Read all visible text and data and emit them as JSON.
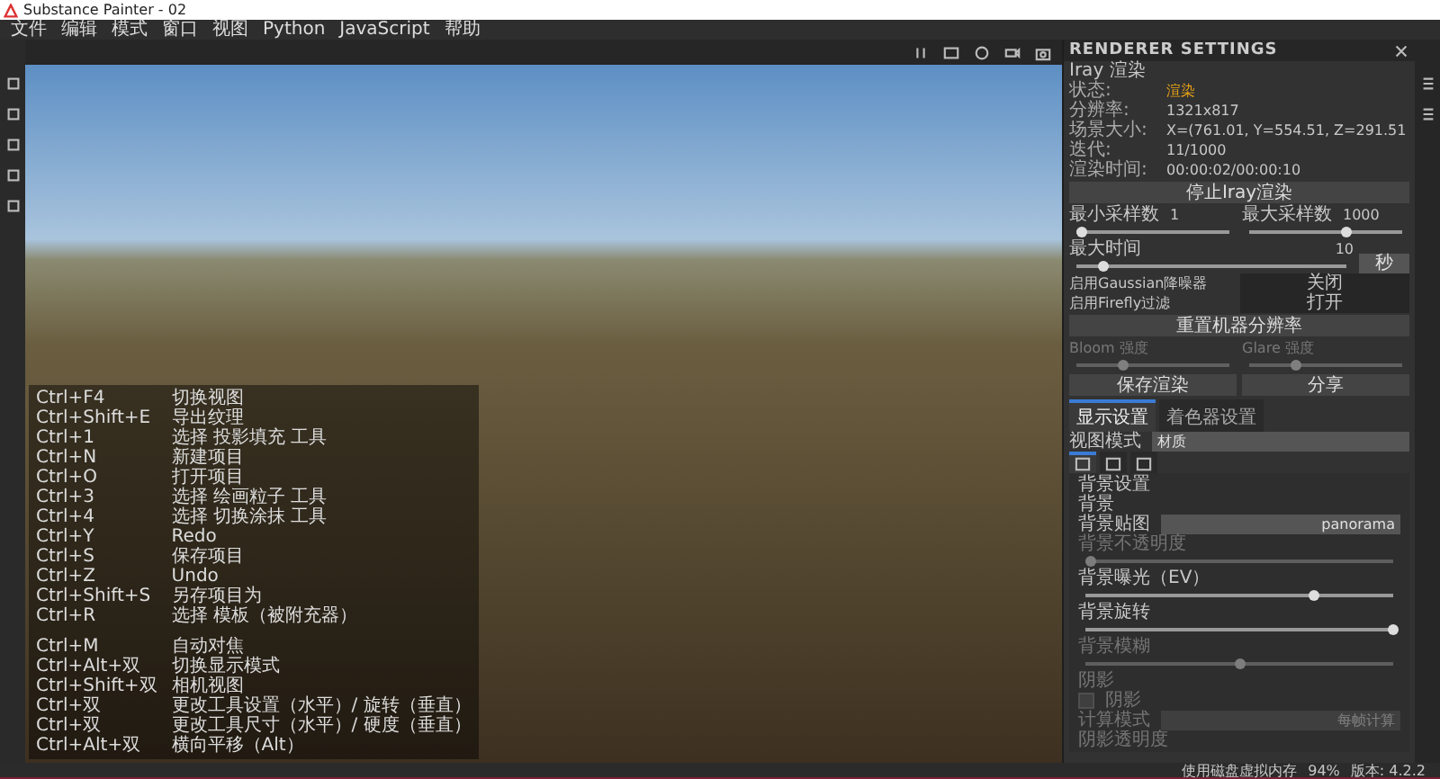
{
  "window": {
    "title": "Substance Painter - 02"
  },
  "menu": [
    "文件",
    "编辑",
    "模式",
    "窗口",
    "视图",
    "Python",
    "JavaScript",
    "帮助"
  ],
  "renderer": {
    "title": "RENDERER SETTINGS",
    "subtitle": "Iray 渲染",
    "info": [
      {
        "label": "状态:",
        "value": "渲染",
        "color": "#e8a317"
      },
      {
        "label": "分辨率:",
        "value": "1321x817"
      },
      {
        "label": "场景大小:",
        "value": "X=(761.01, Y=554.51, Z=291.51"
      },
      {
        "label": "迭代:",
        "value": "11/1000"
      },
      {
        "label": "渲染时间:",
        "value": "00:00:02/00:00:10"
      }
    ],
    "stop_button": "停止Iray渲染",
    "min_samples": {
      "label": "最小采样数",
      "value": "1",
      "level": 0.03
    },
    "max_samples": {
      "label": "最大采样数",
      "value": "1000",
      "level": 0.63
    },
    "max_time": {
      "label": "最大时间",
      "value": "10",
      "level": 0.1,
      "unit": "秒"
    },
    "toggles": [
      {
        "label": "启用Gaussian降噪器",
        "value": "关闭"
      },
      {
        "label": "启用Firefly过滤",
        "value": "打开"
      }
    ],
    "reset_button": "重置机器分辨率",
    "effects": [
      {
        "label": "Bloom 强度",
        "level": 0.3
      },
      {
        "label": "Glare 强度",
        "level": 0.3
      }
    ],
    "save_button": "保存渲染",
    "share_button": "分享"
  },
  "display": {
    "tabs": [
      {
        "label": "显示设置",
        "selected": true
      },
      {
        "label": "着色器设置",
        "selected": false
      }
    ],
    "view_mode": {
      "label": "视图模式",
      "value": "材质"
    },
    "icon_tabs": [
      {
        "selected": true
      },
      {
        "selected": false
      },
      {
        "selected": false
      }
    ],
    "section": "背景设置",
    "group": "背景",
    "rows": [
      {
        "kind": "field",
        "label": "背景贴图",
        "value": "panorama",
        "disabled": false
      },
      {
        "kind": "slider",
        "label": "背景不透明度",
        "level": 0.02,
        "disabled": true
      },
      {
        "kind": "slider",
        "label": "背景曝光（EV）",
        "level": 0.74,
        "disabled": false
      },
      {
        "kind": "slider",
        "label": "背景旋转",
        "level": 1,
        "disabled": false
      },
      {
        "kind": "slider",
        "label": "背景模糊",
        "level": 0.5,
        "disabled": true
      },
      {
        "kind": "heading",
        "label": "阴影",
        "disabled": true
      },
      {
        "kind": "checkbox",
        "label": "阴影",
        "checked": false,
        "disabled": true
      },
      {
        "kind": "field",
        "label": "计算模式",
        "value": "每帧计算",
        "disabled": true
      },
      {
        "kind": "heading",
        "label": "阴影透明度",
        "disabled": true
      }
    ]
  },
  "shortcuts": [
    {
      "keys": "Ctrl+F4",
      "action": "切换视图"
    },
    {
      "keys": "Ctrl+Shift+E",
      "action": "导出纹理"
    },
    {
      "keys": "Ctrl+1",
      "action": "选择 投影填充 工具"
    },
    {
      "keys": "Ctrl+N",
      "action": "新建项目"
    },
    {
      "keys": "Ctrl+O",
      "action": "打开项目"
    },
    {
      "keys": "Ctrl+3",
      "action": "选择 绘画粒子 工具"
    },
    {
      "keys": "Ctrl+4",
      "action": "选择 切换涂抹 工具"
    },
    {
      "keys": "Ctrl+Y",
      "action": "Redo"
    },
    {
      "keys": "Ctrl+S",
      "action": "保存项目"
    },
    {
      "keys": "Ctrl+Z",
      "action": "Undo"
    },
    {
      "keys": "Ctrl+Shift+S",
      "action": "另存项目为"
    },
    {
      "keys": "Ctrl+R",
      "action": "选择 模板（被附充器）"
    },
    {
      "keys": "Ctrl+M",
      "action": "自动对焦"
    },
    {
      "keys": "Ctrl+Alt+双",
      "action": "切换显示模式"
    },
    {
      "keys": "Ctrl+Shift+双",
      "action": "相机视图"
    },
    {
      "keys": "Ctrl+双",
      "action": "更改工具设置（水平）/ 旋转（垂直）"
    },
    {
      "keys": "Ctrl+双",
      "action": "更改工具尺寸（水平）/ 硬度（垂直）"
    },
    {
      "keys": "Ctrl+Alt+双",
      "action": "横向平移（Alt）"
    }
  ],
  "status_bar": {
    "message": "使用磁盘虚拟内存",
    "zoom": "94%",
    "version": "版本: 4.2.2"
  }
}
